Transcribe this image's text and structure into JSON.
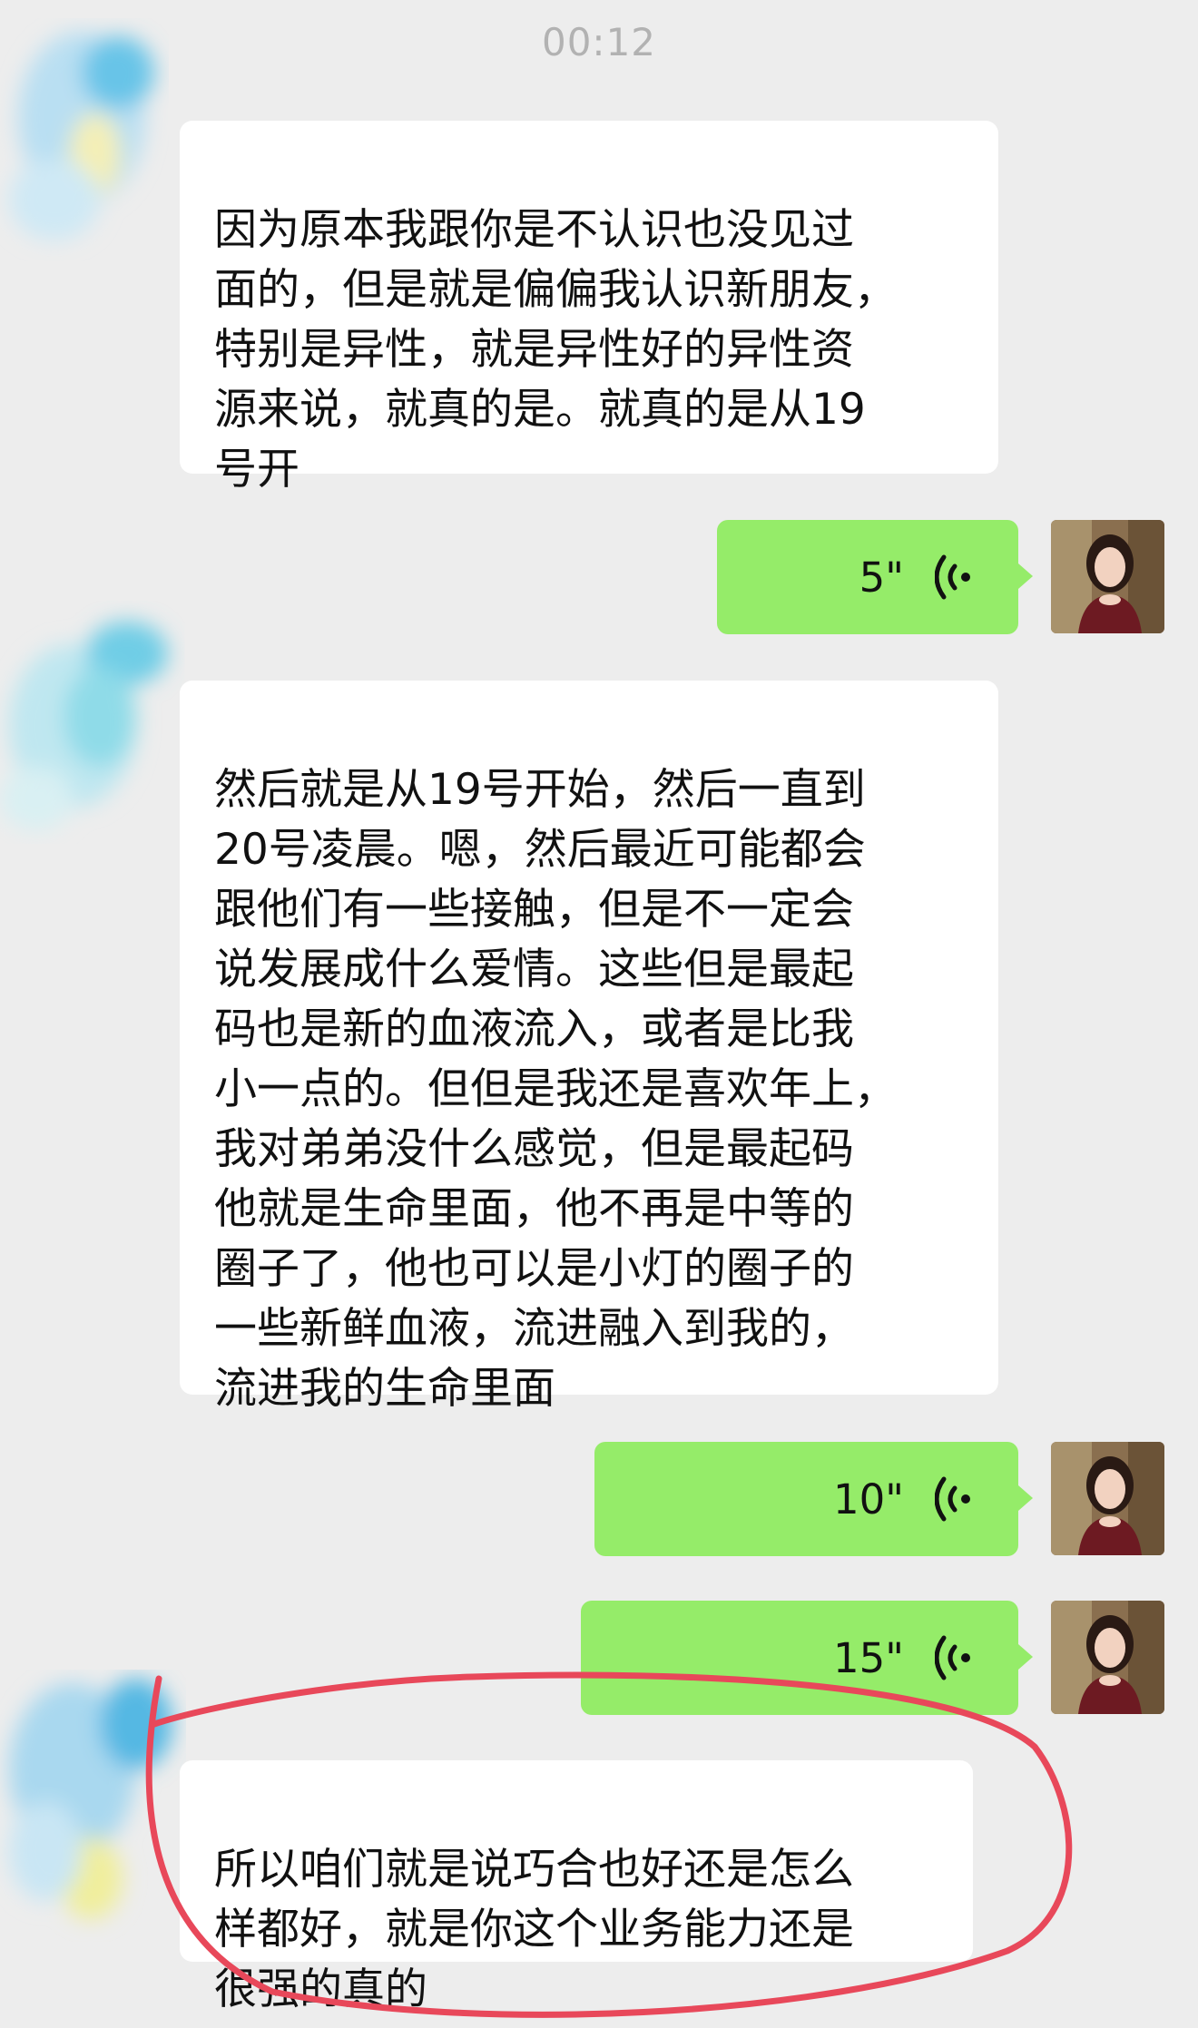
{
  "status": {
    "time": "00:12"
  },
  "messages": [
    {
      "side": "in",
      "text": "因为原本我跟你是不认识也没见过\n面的，但是就是偏偏我认识新朋友，\n特别是异性，就是异性好的异性资\n源来说，就真的是。就真的是从19\n号开"
    },
    {
      "side": "out",
      "duration": "5\""
    },
    {
      "side": "in",
      "text": "然后就是从19号开始，然后一直到\n20号凌晨。嗯，然后最近可能都会\n跟他们有一些接触，但是不一定会\n说发展成什么爱情。这些但是最起\n码也是新的血液流入，或者是比我\n小一点的。但但是我还是喜欢年上，\n我对弟弟没什么感觉，但是最起码\n他就是生命里面，他不再是中等的\n圈子了，他也可以是小灯的圈子的\n一些新鲜血液，流进融入到我的，\n流进我的生命里面"
    },
    {
      "side": "out",
      "duration": "10\""
    },
    {
      "side": "out",
      "duration": "15\""
    },
    {
      "side": "in",
      "text": "所以咱们就是说巧合也好还是怎么\n样都好，就是你这个业务能力还是\n很强的真的"
    }
  ],
  "colors": {
    "background": "#ededed",
    "incoming_bubble": "#ffffff",
    "outgoing_bubble": "#95ec69",
    "highlight_ring": "#e8485a"
  }
}
